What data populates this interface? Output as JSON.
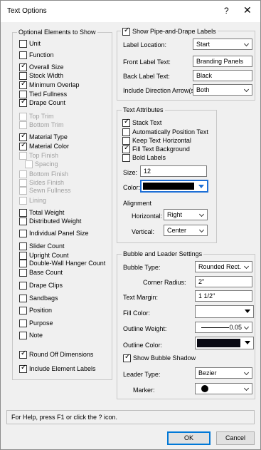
{
  "window": {
    "title": "Text Options",
    "help": "?",
    "close": "✕"
  },
  "optional": {
    "title": "Optional Elements to Show",
    "items": [
      {
        "label": "Unit",
        "checked": false,
        "disabled": false
      },
      {
        "label": "Function",
        "checked": false,
        "disabled": false
      },
      {
        "label": "Overall Size",
        "checked": true,
        "disabled": false
      },
      {
        "label": "Stock Width",
        "checked": false,
        "disabled": false
      },
      {
        "label": "Minimum Overlap",
        "checked": true,
        "disabled": false
      },
      {
        "label": "Tied Fullness",
        "checked": false,
        "disabled": false
      },
      {
        "label": "Drape Count",
        "checked": true,
        "disabled": false
      },
      {
        "label": "Top Trim",
        "checked": false,
        "disabled": true
      },
      {
        "label": "Bottom Trim",
        "checked": false,
        "disabled": true
      },
      {
        "label": "Material Type",
        "checked": true,
        "disabled": false
      },
      {
        "label": "Material Color",
        "checked": true,
        "disabled": false
      },
      {
        "label": "Top Finish",
        "checked": false,
        "disabled": true
      },
      {
        "label": "Spacing",
        "checked": false,
        "disabled": true
      },
      {
        "label": "Bottom Finish",
        "checked": false,
        "disabled": true
      },
      {
        "label": "Sides Finish",
        "checked": false,
        "disabled": true
      },
      {
        "label": "Sewn Fullness",
        "checked": false,
        "disabled": true
      },
      {
        "label": "Lining",
        "checked": false,
        "disabled": true
      },
      {
        "label": "Total Weight",
        "checked": false,
        "disabled": false
      },
      {
        "label": "Distributed Weight",
        "checked": false,
        "disabled": false
      },
      {
        "label": "Individual Panel Size",
        "checked": false,
        "disabled": false
      },
      {
        "label": "Slider Count",
        "checked": false,
        "disabled": false
      },
      {
        "label": "Upright Count",
        "checked": false,
        "disabled": false
      },
      {
        "label": "Double-Wall Hanger Count",
        "checked": false,
        "disabled": false
      },
      {
        "label": "Base Count",
        "checked": false,
        "disabled": false
      },
      {
        "label": "Drape Clips",
        "checked": false,
        "disabled": false
      },
      {
        "label": "Sandbags",
        "checked": false,
        "disabled": false
      },
      {
        "label": "Position",
        "checked": false,
        "disabled": false
      },
      {
        "label": "Purpose",
        "checked": false,
        "disabled": false
      },
      {
        "label": "Note",
        "checked": false,
        "disabled": false
      },
      {
        "label": "Round Off Dimensions",
        "checked": true,
        "disabled": false
      },
      {
        "label": "Include Element Labels",
        "checked": true,
        "disabled": false
      }
    ]
  },
  "pipe": {
    "title": "Show Pipe-and-Drape Labels",
    "checked": true,
    "label_location_label": "Label Location:",
    "label_location_value": "Start",
    "front_label_label": "Front Label Text:",
    "front_label_value": "Branding Panels",
    "back_label_label": "Back Label Text:",
    "back_label_value": "Black",
    "direction_label": "Include Direction Arrow(s):",
    "direction_value": "Both"
  },
  "text_attr": {
    "title": "Text Attributes",
    "stack_text": "Stack Text",
    "stack_text_checked": true,
    "auto_position": "Automatically Position Text",
    "auto_position_checked": false,
    "keep_horizontal": "Keep Text Horizontal",
    "keep_horizontal_checked": false,
    "fill_bg": "Fill Text Background",
    "fill_bg_checked": true,
    "bold": "Bold Labels",
    "bold_checked": false,
    "size_label": "Size:",
    "size_value": "12",
    "color_label": "Color:",
    "color_value": "#000000",
    "alignment_label": "Alignment",
    "horizontal_label": "Horizontal:",
    "horizontal_value": "Right",
    "vertical_label": "Vertical:",
    "vertical_value": "Center"
  },
  "bubble": {
    "title": "Bubble and Leader Settings",
    "type_label": "Bubble Type:",
    "type_value": "Rounded Rect.",
    "radius_label": "Corner Radius:",
    "radius_value": "2\"",
    "margin_label": "Text Margin:",
    "margin_value": "1 1/2\"",
    "fill_label": "Fill Color:",
    "fill_value": "#ffffff",
    "outline_weight_label": "Outline Weight:",
    "outline_weight_value": "0.05",
    "outline_color_label": "Outline Color:",
    "outline_color_value": "#0a0a14",
    "shadow_label": "Show Bubble Shadow",
    "shadow_checked": true,
    "leader_label": "Leader Type:",
    "leader_value": "Bezier",
    "marker_label": "Marker:",
    "marker_value": "filled-circle-icon"
  },
  "status": {
    "text": "For Help, press F1 or click the ? icon."
  },
  "buttons": {
    "ok": "OK",
    "cancel": "Cancel"
  }
}
